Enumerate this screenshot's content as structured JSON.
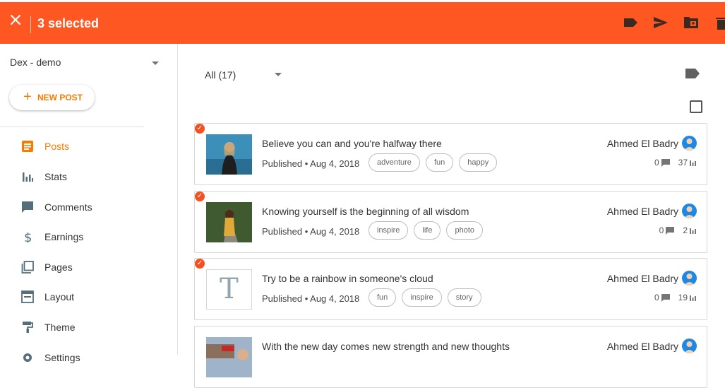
{
  "topbar": {
    "selected_text": "3 selected",
    "bg_color": "#ff5722",
    "icons": [
      "close-icon",
      "label-icon",
      "send-icon",
      "move-to-folder-icon",
      "delete-icon"
    ]
  },
  "sidebar": {
    "blog_name": "Dex - demo",
    "new_post_label": "NEW POST",
    "items": [
      {
        "label": "Posts",
        "icon": "posts-icon",
        "active": true
      },
      {
        "label": "Stats",
        "icon": "stats-icon"
      },
      {
        "label": "Comments",
        "icon": "comments-icon"
      },
      {
        "label": "Earnings",
        "icon": "dollar-icon"
      },
      {
        "label": "Pages",
        "icon": "pages-icon"
      },
      {
        "label": "Layout",
        "icon": "layout-icon"
      },
      {
        "label": "Theme",
        "icon": "theme-icon"
      },
      {
        "label": "Settings",
        "icon": "settings-icon"
      }
    ]
  },
  "main": {
    "filter_value": "All (17)",
    "posts": [
      {
        "title": "Believe you can and you're halfway there",
        "status": "Published • Aug 4, 2018",
        "tags": [
          "adventure",
          "fun",
          "happy"
        ],
        "author": "Ahmed El Badry",
        "comments": "0",
        "views": "37",
        "selected": true,
        "thumb": "blue-portrait"
      },
      {
        "title": "Knowing yourself is the beginning of all wisdom",
        "status": "Published • Aug 4, 2018",
        "tags": [
          "inspire",
          "life",
          "photo"
        ],
        "author": "Ahmed El Badry",
        "comments": "0",
        "views": "2",
        "selected": true,
        "thumb": "forest-portrait"
      },
      {
        "title": "Try to be a rainbow in someone's cloud",
        "status": "Published • Aug 4, 2018",
        "tags": [
          "fun",
          "inspire",
          "story"
        ],
        "author": "Ahmed El Badry",
        "comments": "0",
        "views": "19",
        "selected": true,
        "thumb": "text-placeholder",
        "thumb_letter": "T"
      },
      {
        "title": "With the new day comes new strength and new thoughts",
        "author": "Ahmed El Badry",
        "selected": false,
        "thumb": "street-photo"
      }
    ]
  },
  "colors": {
    "accent": "#f57c00",
    "selection_check": "#f4511e",
    "icon_grey": "#546e7a"
  }
}
